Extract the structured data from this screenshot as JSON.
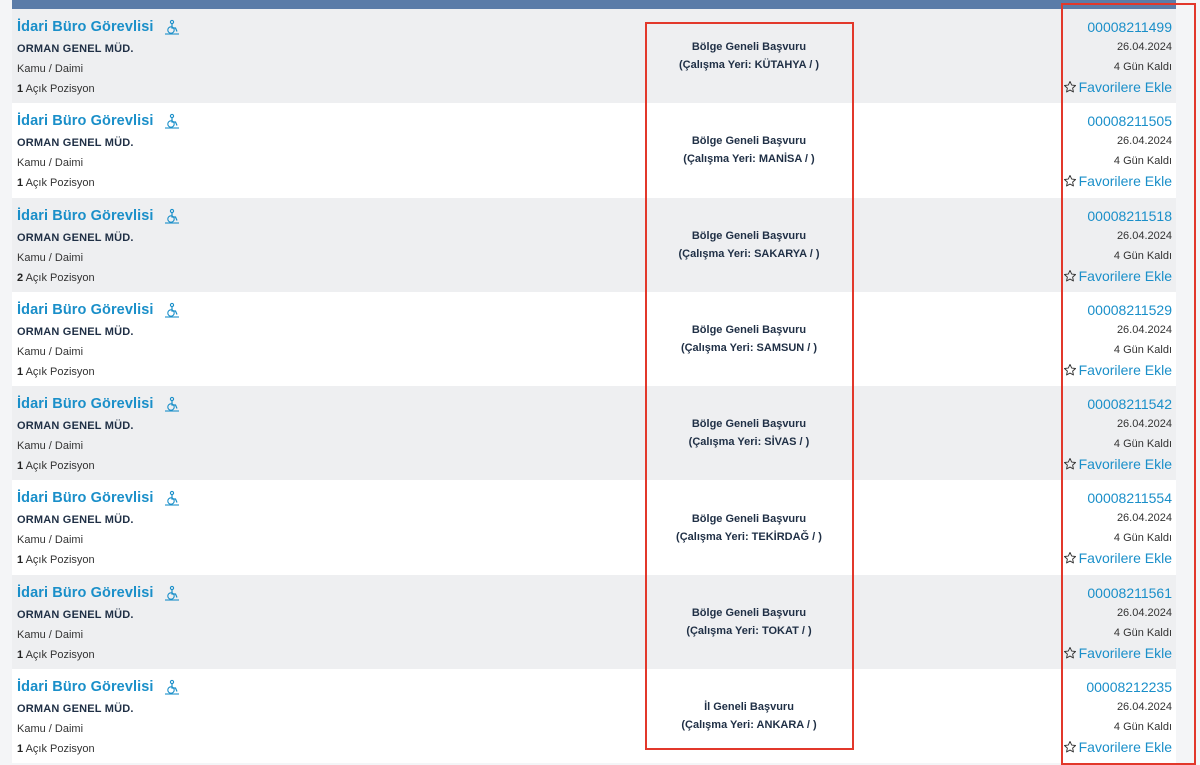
{
  "accent_color": "#1a8fc9",
  "highlight_color": "#e2382b",
  "listings": [
    {
      "title": "İdari Büro Görevlisi",
      "org": "ORMAN GENEL MÜD.",
      "type": "Kamu / Daimi",
      "positions": "1",
      "positions_label": "Açık Pozisyon",
      "scope": "Bölge Geneli Başvuru",
      "location": "(Çalışma Yeri: KÜTAHYA / )",
      "ad_no": "00008211499",
      "date": "26.04.2024",
      "days_left": "4 Gün Kaldı",
      "fav_label": "Favorilere Ekle"
    },
    {
      "title": "İdari Büro Görevlisi",
      "org": "ORMAN GENEL MÜD.",
      "type": "Kamu / Daimi",
      "positions": "1",
      "positions_label": "Açık Pozisyon",
      "scope": "Bölge Geneli Başvuru",
      "location": "(Çalışma Yeri: MANİSA / )",
      "ad_no": "00008211505",
      "date": "26.04.2024",
      "days_left": "4 Gün Kaldı",
      "fav_label": "Favorilere Ekle"
    },
    {
      "title": "İdari Büro Görevlisi",
      "org": "ORMAN GENEL MÜD.",
      "type": "Kamu / Daimi",
      "positions": "2",
      "positions_label": "Açık Pozisyon",
      "scope": "Bölge Geneli Başvuru",
      "location": "(Çalışma Yeri: SAKARYA / )",
      "ad_no": "00008211518",
      "date": "26.04.2024",
      "days_left": "4 Gün Kaldı",
      "fav_label": "Favorilere Ekle"
    },
    {
      "title": "İdari Büro Görevlisi",
      "org": "ORMAN GENEL MÜD.",
      "type": "Kamu / Daimi",
      "positions": "1",
      "positions_label": "Açık Pozisyon",
      "scope": "Bölge Geneli Başvuru",
      "location": "(Çalışma Yeri: SAMSUN / )",
      "ad_no": "00008211529",
      "date": "26.04.2024",
      "days_left": "4 Gün Kaldı",
      "fav_label": "Favorilere Ekle"
    },
    {
      "title": "İdari Büro Görevlisi",
      "org": "ORMAN GENEL MÜD.",
      "type": "Kamu / Daimi",
      "positions": "1",
      "positions_label": "Açık Pozisyon",
      "scope": "Bölge Geneli Başvuru",
      "location": "(Çalışma Yeri: SİVAS / )",
      "ad_no": "00008211542",
      "date": "26.04.2024",
      "days_left": "4 Gün Kaldı",
      "fav_label": "Favorilere Ekle"
    },
    {
      "title": "İdari Büro Görevlisi",
      "org": "ORMAN GENEL MÜD.",
      "type": "Kamu / Daimi",
      "positions": "1",
      "positions_label": "Açık Pozisyon",
      "scope": "Bölge Geneli Başvuru",
      "location": "(Çalışma Yeri: TEKİRDAĞ / )",
      "ad_no": "00008211554",
      "date": "26.04.2024",
      "days_left": "4 Gün Kaldı",
      "fav_label": "Favorilere Ekle"
    },
    {
      "title": "İdari Büro Görevlisi",
      "org": "ORMAN GENEL MÜD.",
      "type": "Kamu / Daimi",
      "positions": "1",
      "positions_label": "Açık Pozisyon",
      "scope": "Bölge Geneli Başvuru",
      "location": "(Çalışma Yeri: TOKAT / )",
      "ad_no": "00008211561",
      "date": "26.04.2024",
      "days_left": "4 Gün Kaldı",
      "fav_label": "Favorilere Ekle"
    },
    {
      "title": "İdari Büro Görevlisi",
      "org": "ORMAN GENEL MÜD.",
      "type": "Kamu / Daimi",
      "positions": "1",
      "positions_label": "Açık Pozisyon",
      "scope": "İl Geneli Başvuru",
      "location": "(Çalışma Yeri: ANKARA / )",
      "ad_no": "00008212235",
      "date": "26.04.2024",
      "days_left": "4 Gün Kaldı",
      "fav_label": "Favorilere Ekle"
    }
  ]
}
